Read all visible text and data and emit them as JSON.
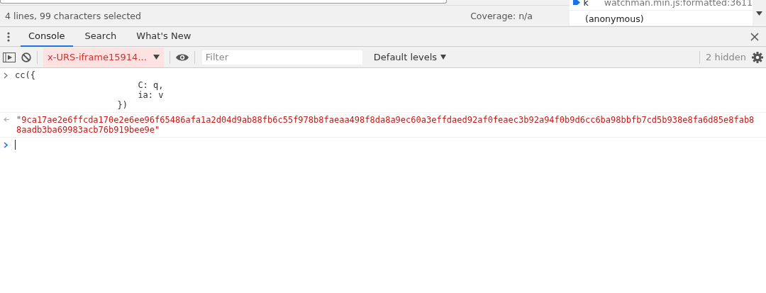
{
  "top_status": {
    "selection": "4 lines, 99 characters selected",
    "coverage": "Coverage: n/a"
  },
  "call_stack": [
    {
      "name": "k",
      "location": "watchman.min.js:formatted:3611",
      "selected": true
    },
    {
      "name": "(anonymous)",
      "selected": false
    }
  ],
  "drawer_tabs": [
    {
      "label": "Console",
      "selected": true
    },
    {
      "label": "Search",
      "selected": false
    },
    {
      "label": "What's New",
      "selected": false
    }
  ],
  "toolbar": {
    "context": "x-URS-iframe15914...",
    "filter_placeholder": "Filter",
    "levels": "Default levels",
    "hidden": "2 hidden"
  },
  "console": [
    {
      "kind": "input",
      "text": "cc({\n                        C: q,\n                        ia: v\n                    })"
    },
    {
      "kind": "result",
      "text": "\"9ca17ae2e6ffcda170e2e6ee96f65486afa1a2d04d9ab88fb6c55f978b8faeaa498f8da8a9ec60a3effdaed92af0feaec3b92a94f0b9d6cc6ba98bbfb7cd5b938e8fa6d85e8fab88aadb3ba69983acb76b919bee9e\""
    },
    {
      "kind": "prompt"
    }
  ]
}
